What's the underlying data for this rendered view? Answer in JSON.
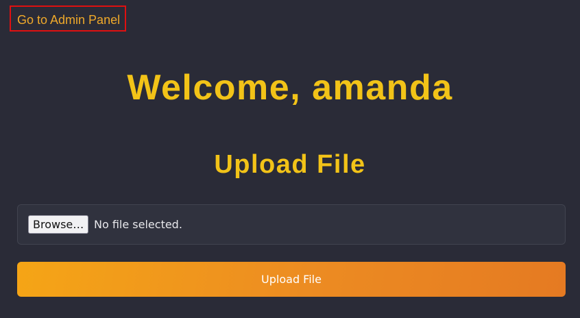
{
  "nav": {
    "admin_link_label": "Go to Admin Panel"
  },
  "header": {
    "welcome_text": "Welcome, amanda"
  },
  "upload": {
    "title": "Upload File",
    "browse_label": "Browse…",
    "file_status": "No file selected.",
    "submit_label": "Upload File"
  },
  "colors": {
    "background": "#2a2b37",
    "heading": "#f2c318",
    "link": "#f0a92a",
    "link_border": "#e01010",
    "button_gradient_start": "#f5a516",
    "button_gradient_end": "#e57a22"
  }
}
